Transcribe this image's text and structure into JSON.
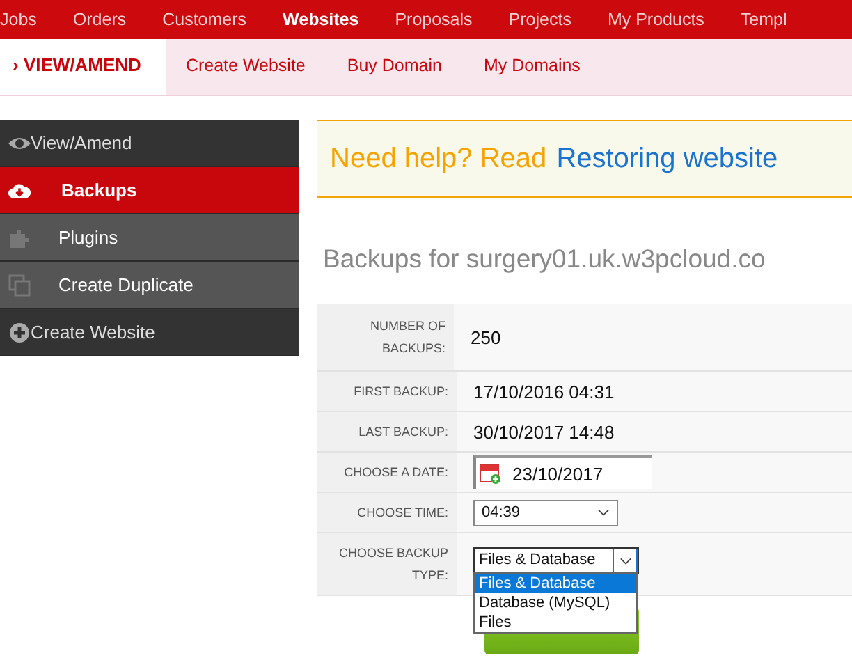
{
  "top_nav": [
    {
      "label": "Jobs",
      "selected": false
    },
    {
      "label": "Orders",
      "selected": false
    },
    {
      "label": "Customers",
      "selected": false
    },
    {
      "label": "Websites",
      "selected": true
    },
    {
      "label": "Proposals",
      "selected": false
    },
    {
      "label": "Projects",
      "selected": false
    },
    {
      "label": "My Products",
      "selected": false
    },
    {
      "label": "Templ",
      "selected": false
    }
  ],
  "sub_nav": [
    {
      "label": "› VIEW/AMEND",
      "selected": true
    },
    {
      "label": "Create Website",
      "selected": false
    },
    {
      "label": "Buy Domain",
      "selected": false
    },
    {
      "label": "My Domains",
      "selected": false
    }
  ],
  "sidebar": {
    "items": [
      {
        "label": "View/Amend",
        "kind": "eye",
        "selected": false,
        "children": [
          {
            "label": "Backups",
            "kind": "cloud",
            "selected": true
          },
          {
            "label": "Plugins",
            "kind": "puzzle",
            "selected": false
          },
          {
            "label": "Create Duplicate",
            "kind": "copy",
            "selected": false
          }
        ]
      },
      {
        "label": "Create Website",
        "kind": "plus",
        "selected": false
      }
    ]
  },
  "help_banner": {
    "text": "Need help? Read",
    "link": "Restoring website"
  },
  "heading": "Backups for surgery01.uk.w3pcloud.co",
  "form": {
    "rows": [
      {
        "label": "NUMBER OF BACKUPS:",
        "kind": "text",
        "value": "250"
      },
      {
        "label": "FIRST BACKUP:",
        "kind": "text",
        "value": "17/10/2016 04:31"
      },
      {
        "label": "LAST BACKUP:",
        "kind": "text",
        "value": "30/10/2017 14:48"
      },
      {
        "label": "CHOOSE A DATE:",
        "kind": "date",
        "value": "23/10/2017"
      },
      {
        "label": "CHOOSE TIME:",
        "kind": "select",
        "value": "04:39"
      },
      {
        "label": "CHOOSE BACKUP TYPE:",
        "kind": "open_select",
        "value": "Files & Database",
        "options": [
          {
            "label": "Files & Database",
            "selected": true
          },
          {
            "label": "Database (MySQL)",
            "selected": false
          },
          {
            "label": "Files",
            "selected": false
          }
        ]
      }
    ]
  },
  "restore_button": {
    "kind": "button"
  }
}
